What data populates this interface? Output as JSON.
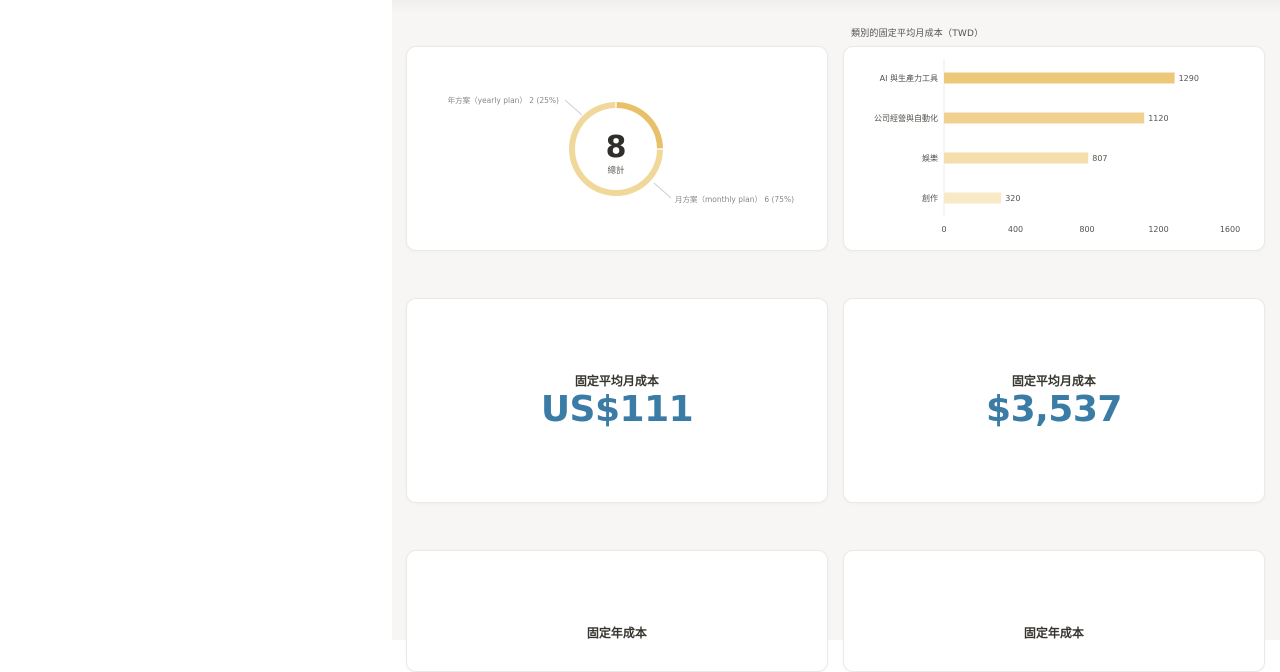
{
  "donut_card": {
    "total": "8",
    "total_label": "總計",
    "label_yearly": "年方案（yearly plan） 2 (25%)",
    "label_monthly": "月方案（monthly plan） 6 (75%)",
    "colors": {
      "yearly": "#e8c06a",
      "monthly": "#f0d79a"
    }
  },
  "bar_card": {
    "title": "類別的固定平均月成本（TWD）",
    "colors": [
      "#edc878",
      "#f1d18f",
      "#f4dfac",
      "#f8e9c7"
    ]
  },
  "stats": {
    "usd_label": "固定平均月成本",
    "usd_value": "US$111",
    "twd_label": "固定平均月成本",
    "twd_value": "$3,537",
    "annual_label_1": "固定年成本",
    "annual_label_2": "固定年成本"
  },
  "chart_data": [
    {
      "type": "pie",
      "variant": "donut",
      "categories": [
        "年方案（yearly plan）",
        "月方案（monthly plan）"
      ],
      "values": [
        2,
        6
      ],
      "percent_labels": [
        "25%",
        "75%"
      ],
      "center_value": "8",
      "center_label": "總計"
    },
    {
      "type": "bar",
      "orientation": "horizontal",
      "title": "類別的固定平均月成本（TWD）",
      "categories": [
        "AI 與生產力工具",
        "公司經營與自動化",
        "娛樂",
        "創作"
      ],
      "values": [
        1290,
        1120,
        807,
        320
      ],
      "xlim": [
        0,
        1600
      ],
      "xticks": [
        "0",
        "400",
        "800",
        "1200",
        "1600"
      ],
      "grid": false
    }
  ]
}
